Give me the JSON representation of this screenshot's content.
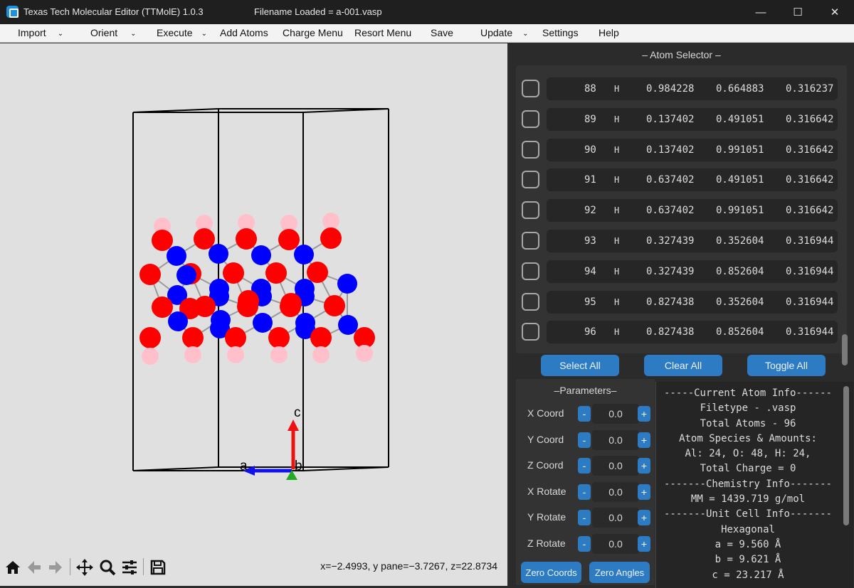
{
  "window": {
    "app_title": "Texas Tech Molecular Editor (TTMolE) 1.0.3",
    "file_title": "Filename Loaded = a-001.vasp",
    "minimize": "—",
    "maximize": "☐",
    "close": "✕"
  },
  "menu": [
    {
      "label": "Import",
      "chevron": "⌄"
    },
    {
      "label": "Orient",
      "chevron": "⌄"
    },
    {
      "label": "Execute",
      "chevron": "⌄"
    },
    {
      "label": "Add Atoms"
    },
    {
      "label": "Charge Menu"
    },
    {
      "label": "Resort Menu"
    },
    {
      "label": "Save"
    },
    {
      "label": "Update",
      "chevron": "⌄"
    },
    {
      "label": "Settings"
    },
    {
      "label": "Help"
    }
  ],
  "viewer": {
    "axis_labels": {
      "c": "c",
      "a": "a",
      "b": "b"
    },
    "colors": {
      "Al": "#0000ff",
      "O": "#ff0000",
      "H": "#ffc0cb",
      "bond": "#9a9a9a",
      "cell": "#000000"
    },
    "toolbar_icons": [
      "home-icon",
      "back-arrow-icon",
      "forward-arrow-icon",
      "pan-icon",
      "zoom-icon",
      "configure-subplots-icon",
      "save-figure-icon"
    ],
    "coord_readout": "x=−2.4993, y pane=−3.7267, z=22.8734"
  },
  "atom_selector": {
    "title": "– Atom Selector –",
    "rows": [
      {
        "index": "88",
        "element": "H",
        "x": "0.984228",
        "y": "0.664883",
        "z": "0.316237"
      },
      {
        "index": "89",
        "element": "H",
        "x": "0.137402",
        "y": "0.491051",
        "z": "0.316642"
      },
      {
        "index": "90",
        "element": "H",
        "x": "0.137402",
        "y": "0.991051",
        "z": "0.316642"
      },
      {
        "index": "91",
        "element": "H",
        "x": "0.637402",
        "y": "0.491051",
        "z": "0.316642"
      },
      {
        "index": "92",
        "element": "H",
        "x": "0.637402",
        "y": "0.991051",
        "z": "0.316642"
      },
      {
        "index": "93",
        "element": "H",
        "x": "0.327439",
        "y": "0.352604",
        "z": "0.316944"
      },
      {
        "index": "94",
        "element": "H",
        "x": "0.327439",
        "y": "0.852604",
        "z": "0.316944"
      },
      {
        "index": "95",
        "element": "H",
        "x": "0.827438",
        "y": "0.352604",
        "z": "0.316944"
      },
      {
        "index": "96",
        "element": "H",
        "x": "0.827438",
        "y": "0.852604",
        "z": "0.316944"
      }
    ],
    "buttons": {
      "select_all": "Select All",
      "clear_all": "Clear All",
      "toggle_all": "Toggle All"
    }
  },
  "parameters": {
    "title": "–Parameters–",
    "rows": [
      {
        "label": "X Coord",
        "value": "0.0"
      },
      {
        "label": "Y Coord",
        "value": "0.0"
      },
      {
        "label": "Z Coord",
        "value": "0.0"
      },
      {
        "label": "X Rotate",
        "value": "0.0"
      },
      {
        "label": "Y Rotate",
        "value": "0.0"
      },
      {
        "label": "Z Rotate",
        "value": "0.0"
      }
    ],
    "minus": "-",
    "plus": "+",
    "zero_coords": "Zero Coords",
    "zero_angles": "Zero Angles"
  },
  "info": {
    "lines": [
      "-----Current Atom Info------",
      "Filetype - .vasp",
      "Total Atoms - 96",
      "Atom Species & Amounts:",
      "Al: 24, O: 48, H: 24,",
      "Total Charge = 0",
      "-------Chemistry Info-------",
      "MM = 1439.719 g/mol",
      "-------Unit Cell Info-------",
      "Hexagonal",
      "a = 9.560 Å",
      "b = 9.621 Å",
      "c = 23.217 Å"
    ]
  }
}
